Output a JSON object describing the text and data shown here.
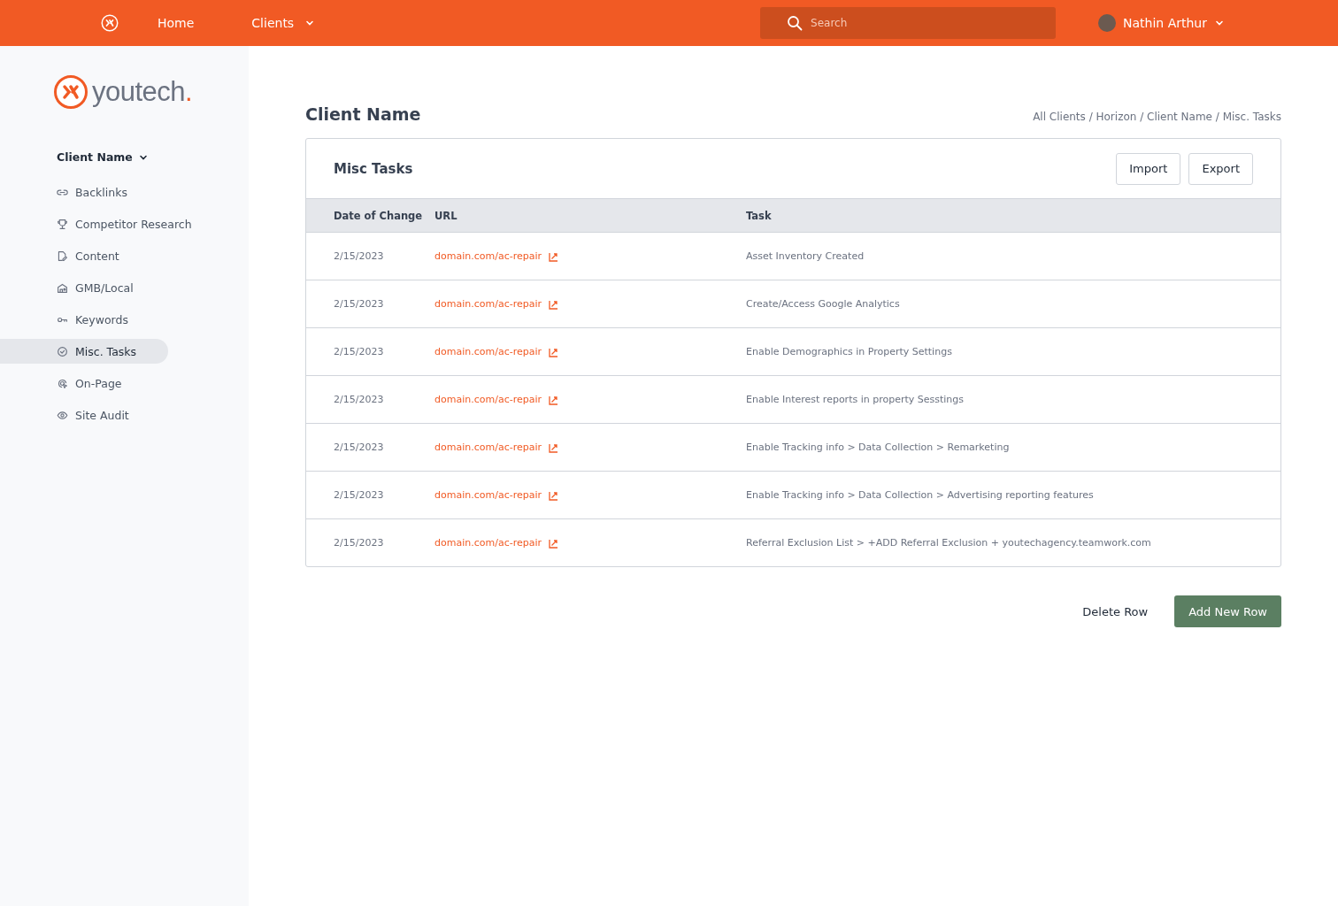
{
  "topbar": {
    "nav": [
      {
        "label": "Home",
        "dropdown": false
      },
      {
        "label": "Clients",
        "dropdown": true
      }
    ],
    "search": {
      "placeholder": "Search"
    },
    "user": {
      "name": "Nathin Arthur"
    }
  },
  "sidebar": {
    "logo": {
      "text": "youtech",
      "mark": "."
    },
    "client": "Client Name",
    "items": [
      {
        "label": "Backlinks",
        "selected": false
      },
      {
        "label": "Competitor Research",
        "selected": false
      },
      {
        "label": "Content",
        "selected": false
      },
      {
        "label": "GMB/Local",
        "selected": false
      },
      {
        "label": "Keywords",
        "selected": false
      },
      {
        "label": "Misc. Tasks",
        "selected": true
      },
      {
        "label": "On-Page",
        "selected": false
      },
      {
        "label": "Site Audit",
        "selected": false
      }
    ]
  },
  "page": {
    "title": "Client Name",
    "breadcrumb": "All Clients /  Horizon / Client Name / Misc. Tasks"
  },
  "card": {
    "title": "Misc Tasks",
    "buttons": [
      "Import",
      "Export"
    ],
    "table": {
      "columns": [
        "Date of Change",
        "URL",
        "Task"
      ],
      "rows": [
        {
          "date": "2/15/2023",
          "url": "domain.com/ac-repair",
          "task": "Asset Inventory Created"
        },
        {
          "date": "2/15/2023",
          "url": "domain.com/ac-repair",
          "task": "Create/Access Google Analytics"
        },
        {
          "date": "2/15/2023",
          "url": "domain.com/ac-repair",
          "task": "Enable Demographics in Property Settings"
        },
        {
          "date": "2/15/2023",
          "url": "domain.com/ac-repair",
          "task": "Enable Interest reports in property Sesstings"
        },
        {
          "date": "2/15/2023",
          "url": "domain.com/ac-repair",
          "task": "Enable Tracking info > Data Collection > Remarketing"
        },
        {
          "date": "2/15/2023",
          "url": "domain.com/ac-repair",
          "task": "Enable Tracking info > Data Collection > Advertising reporting features"
        },
        {
          "date": "2/15/2023",
          "url": "domain.com/ac-repair",
          "task": "Referral Exclusion List > +ADD Referral Exclusion + youtechagency.teamwork.com"
        }
      ]
    }
  },
  "actions": {
    "secondary": "Delete Row",
    "primary": "Add New Row"
  }
}
